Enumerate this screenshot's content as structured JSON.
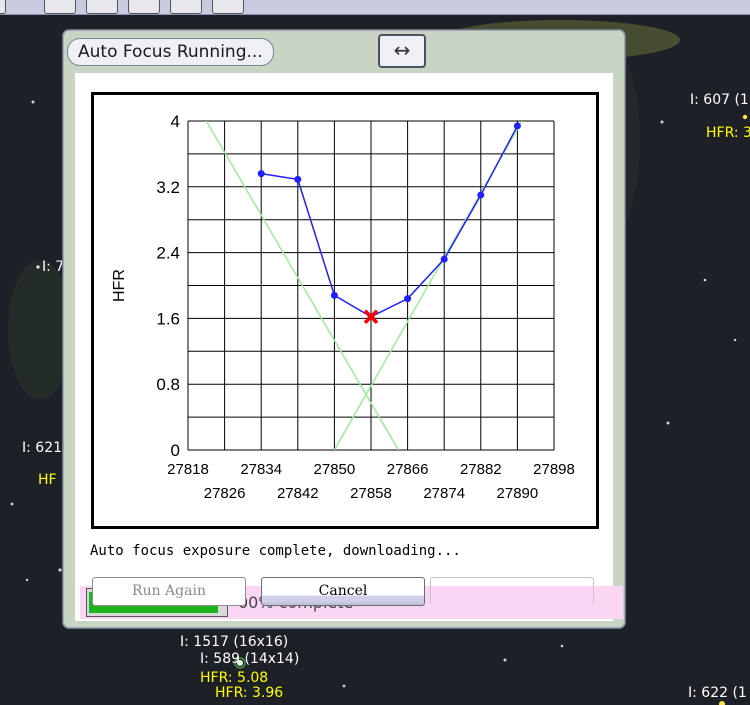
{
  "dialog": {
    "title": "Auto Focus Running...",
    "expand_icon": "double-arrow-horizontal-icon",
    "status_text": "Auto focus exposure complete, downloading...",
    "progress": {
      "fraction": 0.95,
      "label": "00% complete",
      "color": "#1db51d"
    },
    "buttons": {
      "run_again": "Run Again",
      "cancel": "Cancel"
    }
  },
  "star_labels": [
    {
      "text": "I: 607 (1",
      "color": "white"
    },
    {
      "text": "HFR: 3",
      "color": "yellow"
    },
    {
      "text": "I: 7",
      "color": "white"
    },
    {
      "text": "I: 621",
      "color": "white"
    },
    {
      "text": "HF",
      "color": "yellow"
    },
    {
      "text": "I: 1517 (16x16)",
      "color": "white"
    },
    {
      "text": "I: 589 (14x14)",
      "color": "white"
    },
    {
      "text": "HFR: 5.08",
      "color": "yellow"
    },
    {
      "text": "HFR: 3.96",
      "color": "yellow"
    },
    {
      "text": "I: 622 (1",
      "color": "white"
    }
  ],
  "chart_data": {
    "type": "line",
    "ylabel": "HFR",
    "xlabel": "",
    "xlim": [
      27818,
      27898
    ],
    "ylim": [
      0,
      4
    ],
    "x_ticks_top": [
      "27818",
      "27834",
      "27850",
      "27866",
      "27882",
      "27898"
    ],
    "x_ticks_bottom": [
      "27826",
      "27842",
      "27858",
      "27874",
      "27890"
    ],
    "y_ticks": [
      "0",
      "0.8",
      "1.6",
      "2.4",
      "3.2",
      "4"
    ],
    "grid": true,
    "series": [
      {
        "type": "line",
        "color": "#1f1fff",
        "x": [
          27834,
          27842,
          27850,
          27858,
          27866,
          27874,
          27882,
          27890
        ],
        "y": [
          3.36,
          3.29,
          1.88,
          1.62,
          1.84,
          2.32,
          3.1,
          3.94
        ]
      },
      {
        "type": "fit-line",
        "color": "#99ee99",
        "x": [
          27822,
          27864
        ],
        "y": [
          4.0,
          0.0
        ]
      },
      {
        "type": "fit-line",
        "color": "#99ee99",
        "x": [
          27850,
          27891
        ],
        "y": [
          0.0,
          4.0
        ]
      }
    ],
    "best_focus": {
      "x": 27858,
      "y": 1.62,
      "color": "#ff0000",
      "marker": "x"
    }
  }
}
